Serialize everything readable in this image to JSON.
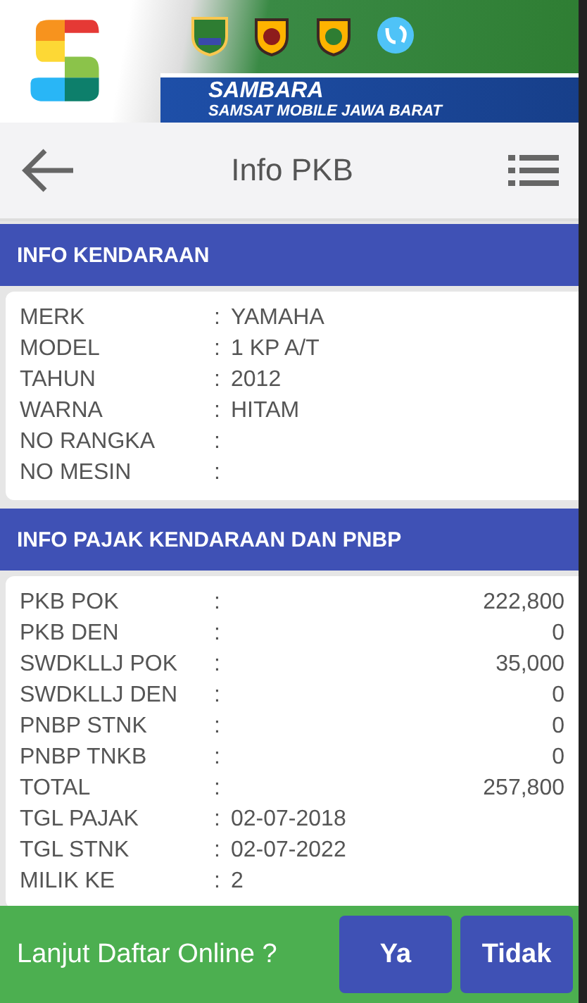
{
  "banner": {
    "title": "SAMBARA",
    "subtitle": "SAMSAT MOBILE JAWA BARAT"
  },
  "toolbar": {
    "title": "Info PKB"
  },
  "sections": [
    {
      "title": "INFO KENDARAAN",
      "rows": [
        {
          "kind": "text",
          "label": "MERK",
          "separator": ":",
          "value": "YAMAHA"
        },
        {
          "kind": "text",
          "label": "MODEL",
          "separator": ":",
          "value": "1 KP A/T"
        },
        {
          "kind": "text",
          "label": "TAHUN",
          "separator": ":",
          "value": "2012"
        },
        {
          "kind": "text",
          "label": "WARNA",
          "separator": ":",
          "value": "HITAM"
        },
        {
          "label": "NO RANGKA",
          "separator": ":"
        },
        {
          "label": "NO MESIN",
          "separator": ":"
        }
      ]
    },
    {
      "title": "INFO PAJAK KENDARAAN DAN PNBP",
      "rows": [
        {
          "kind": "amount",
          "label": "PKB POK",
          "separator": ":",
          "value": "222,800"
        },
        {
          "kind": "amount",
          "label": "PKB DEN",
          "separator": ":",
          "value": "0"
        },
        {
          "kind": "amount",
          "label": "SWDKLLJ POK",
          "separator": ":",
          "value": "35,000"
        },
        {
          "kind": "amount",
          "label": "SWDKLLJ DEN",
          "separator": ":",
          "value": "0"
        },
        {
          "kind": "amount",
          "label": "PNBP STNK",
          "separator": ":",
          "value": "0"
        },
        {
          "kind": "amount",
          "label": "PNBP TNKB",
          "separator": ":",
          "value": "0"
        },
        {
          "kind": "amount",
          "label": "TOTAL",
          "separator": ":",
          "value": "257,800"
        },
        {
          "kind": "text",
          "label": "TGL PAJAK",
          "separator": ":",
          "value": "02-07-2018"
        },
        {
          "kind": "text",
          "label": "TGL STNK",
          "separator": ":",
          "value": "02-07-2022"
        },
        {
          "kind": "text",
          "label": "MILIK KE",
          "separator": ":",
          "value": "2"
        }
      ]
    }
  ],
  "prompt": {
    "question": "Lanjut Daftar Online ?",
    "buttons": [
      "Ya",
      "Tidak"
    ]
  }
}
